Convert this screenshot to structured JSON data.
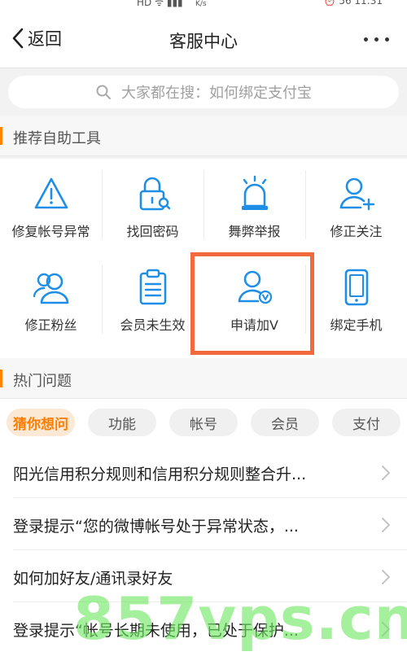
{
  "status_bar": {
    "left": "HD ᯤ ▮▮▮",
    "speed": "K/s",
    "right": "⏰ 56 11:31"
  },
  "nav": {
    "back_label": "返回",
    "title": "客服中心"
  },
  "search": {
    "placeholder": "大家都在搜：如何绑定支付宝"
  },
  "tools_section": {
    "title": "推荐自助工具",
    "items": [
      {
        "label": "修复帐号异常",
        "icon": "warning-triangle-icon"
      },
      {
        "label": "找回密码",
        "icon": "lock-search-icon"
      },
      {
        "label": "舞弊举报",
        "icon": "alarm-siren-icon"
      },
      {
        "label": "修正关注",
        "icon": "user-add-icon"
      },
      {
        "label": "修正粉丝",
        "icon": "users-icon"
      },
      {
        "label": "会员未生效",
        "icon": "clipboard-icon"
      },
      {
        "label": "申请加V",
        "icon": "user-verified-icon"
      },
      {
        "label": "绑定手机",
        "icon": "mobile-phone-icon"
      }
    ]
  },
  "hot_section": {
    "title": "热门问题",
    "tabs": [
      {
        "label": "猜你想问",
        "active": true
      },
      {
        "label": "功能",
        "active": false
      },
      {
        "label": "帐号",
        "active": false
      },
      {
        "label": "会员",
        "active": false
      },
      {
        "label": "支付",
        "active": false
      }
    ],
    "questions": [
      "阳光信用积分规则和信用积分规则整合升...",
      "登录提示“您的微博帐号处于异常状态，...",
      "如何加好友/通讯录好友",
      "登录提示“帐号长期未使用，已处于保护..."
    ]
  },
  "watermark": "857vps.cn",
  "colors": {
    "accent": "#ff8200",
    "icon_blue": "#1e8ee6",
    "highlight": "#f06a3d"
  }
}
